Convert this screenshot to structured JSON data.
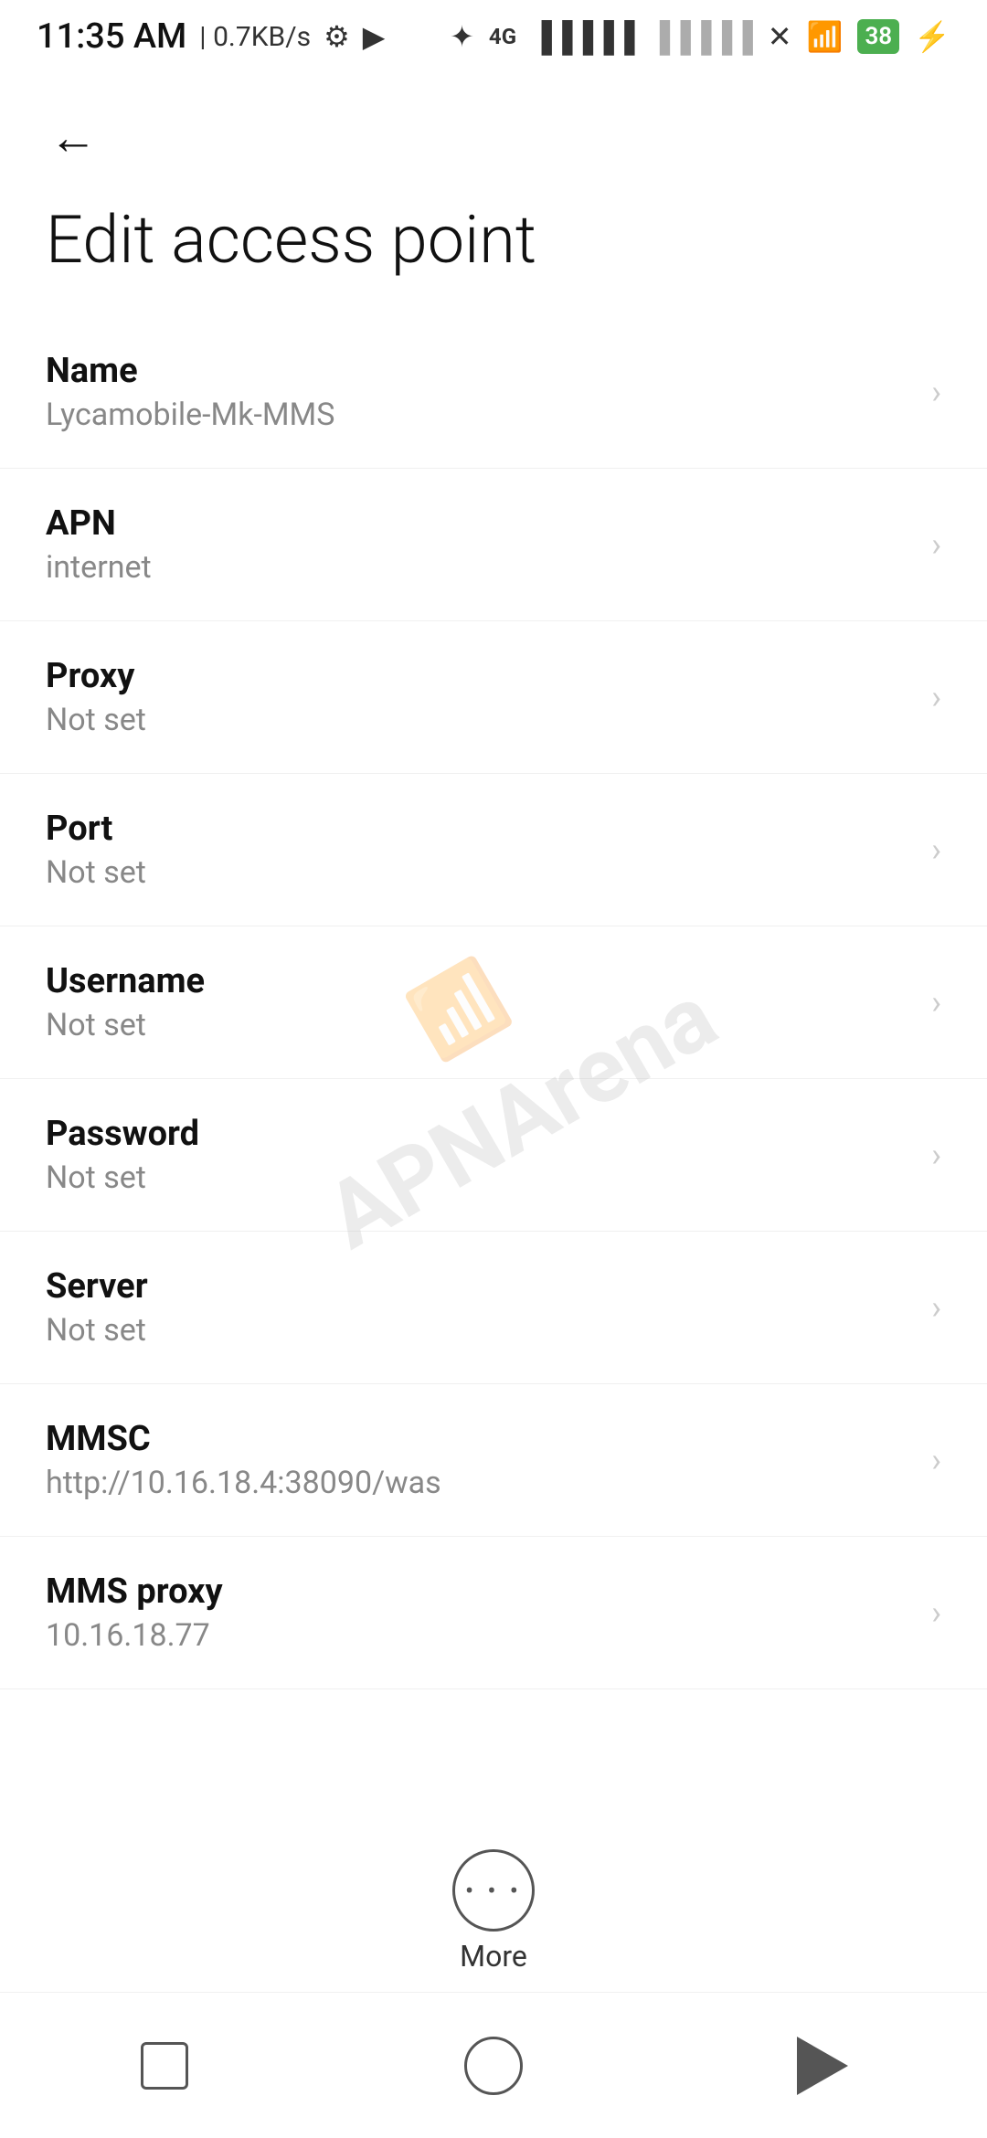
{
  "statusBar": {
    "time": "11:35 AM",
    "speed": "0.7KB/s"
  },
  "header": {
    "back_label": "←",
    "title": "Edit access point"
  },
  "settings": {
    "items": [
      {
        "label": "Name",
        "value": "Lycamobile-Mk-MMS"
      },
      {
        "label": "APN",
        "value": "internet"
      },
      {
        "label": "Proxy",
        "value": "Not set"
      },
      {
        "label": "Port",
        "value": "Not set"
      },
      {
        "label": "Username",
        "value": "Not set"
      },
      {
        "label": "Password",
        "value": "Not set"
      },
      {
        "label": "Server",
        "value": "Not set"
      },
      {
        "label": "MMSC",
        "value": "http://10.16.18.4:38090/was"
      },
      {
        "label": "MMS proxy",
        "value": "10.16.18.77"
      }
    ]
  },
  "more": {
    "label": "More"
  },
  "watermark": {
    "line1": "APNArena"
  }
}
